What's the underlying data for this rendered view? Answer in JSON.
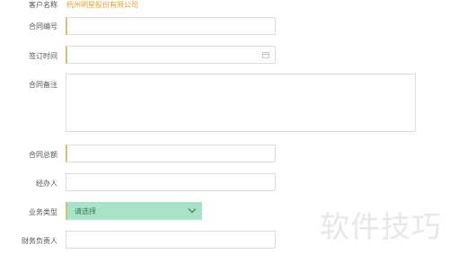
{
  "form": {
    "customer_name": {
      "label": "客户名称",
      "value": "杭州明星股份有限公司"
    },
    "contract_no": {
      "label": "合同编号",
      "value": ""
    },
    "sign_date": {
      "label": "签订时间",
      "value": ""
    },
    "remark": {
      "label": "合同备注",
      "value": ""
    },
    "total_amount": {
      "label": "合同总额",
      "value": ""
    },
    "handler": {
      "label": "经办人",
      "value": ""
    },
    "business_type": {
      "label": "业务类型",
      "value": "请选择"
    },
    "finance_owner": {
      "label": "财务负责人",
      "value": ""
    }
  },
  "watermark": "软件技巧",
  "colors": {
    "accent": "#e0a030",
    "select_bg": "#a8e2c7",
    "required_mark": "#d9c07a"
  }
}
